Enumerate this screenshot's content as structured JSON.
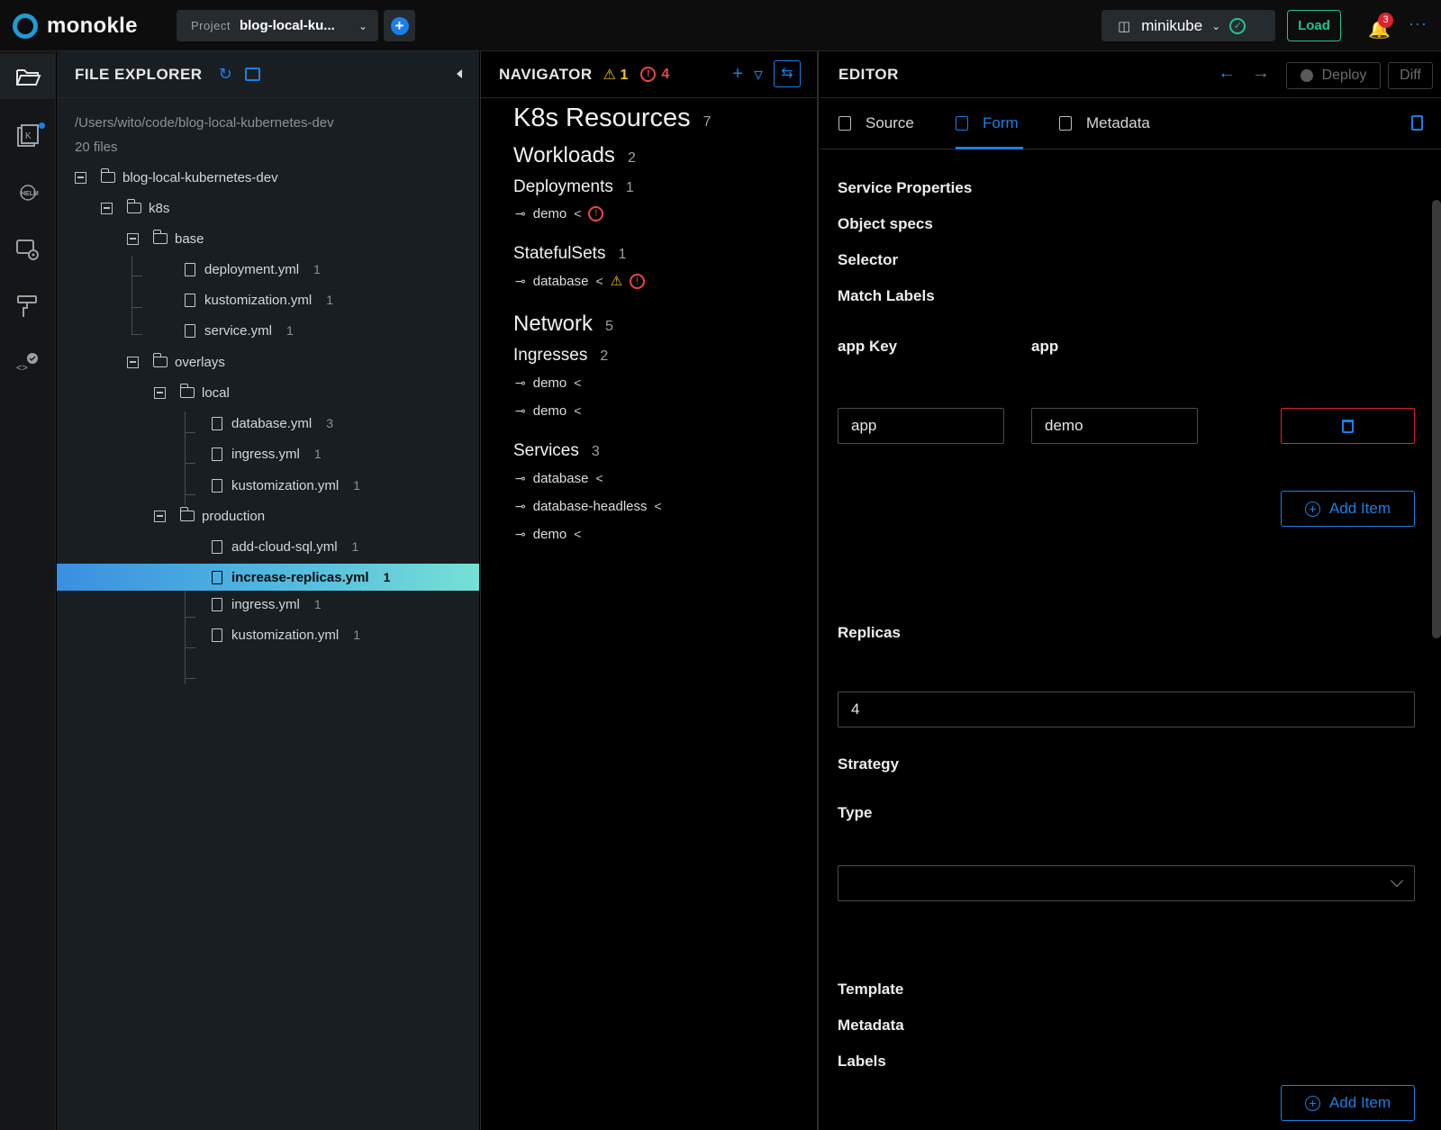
{
  "app": {
    "name": "monokle"
  },
  "topbar": {
    "project_label": "Project",
    "project_name": "blog-local-ku...",
    "cluster_name": "minikube",
    "load_label": "Load",
    "notification_count": "3"
  },
  "explorer": {
    "title": "FILE EXPLORER",
    "path": "/Users/wito/code/blog-local-kubernetes-dev",
    "file_count": "20 files",
    "tree": [
      {
        "label": "blog-local-kubernetes-dev",
        "type": "folder",
        "count": ""
      },
      {
        "label": "k8s",
        "type": "folder",
        "count": ""
      },
      {
        "label": "base",
        "type": "folder",
        "count": ""
      },
      {
        "label": "deployment.yml",
        "type": "file",
        "count": "1"
      },
      {
        "label": "kustomization.yml",
        "type": "file",
        "count": "1"
      },
      {
        "label": "service.yml",
        "type": "file",
        "count": "1"
      },
      {
        "label": "overlays",
        "type": "folder",
        "count": ""
      },
      {
        "label": "local",
        "type": "folder",
        "count": ""
      },
      {
        "label": "database.yml",
        "type": "file",
        "count": "3"
      },
      {
        "label": "ingress.yml",
        "type": "file",
        "count": "1"
      },
      {
        "label": "kustomization.yml",
        "type": "file",
        "count": "1"
      },
      {
        "label": "production",
        "type": "folder",
        "count": ""
      },
      {
        "label": "add-cloud-sql.yml",
        "type": "file",
        "count": "1"
      },
      {
        "label": "increase-replicas.yml",
        "type": "file",
        "count": "1",
        "selected": true
      },
      {
        "label": "ingress.yml",
        "type": "file",
        "count": "1"
      },
      {
        "label": "kustomization.yml",
        "type": "file",
        "count": "1"
      }
    ]
  },
  "navigator": {
    "title": "NAVIGATOR",
    "warning_count": "1",
    "error_count": "4",
    "root": {
      "label": "K8s Resources",
      "count": "7"
    },
    "workloads": {
      "label": "Workloads",
      "count": "2"
    },
    "deployments": {
      "label": "Deployments",
      "count": "1",
      "items": [
        "demo"
      ]
    },
    "statefulsets": {
      "label": "StatefulSets",
      "count": "1",
      "items": [
        "database"
      ]
    },
    "network": {
      "label": "Network",
      "count": "5"
    },
    "ingresses": {
      "label": "Ingresses",
      "count": "2",
      "items": [
        "demo",
        "demo"
      ]
    },
    "services": {
      "label": "Services",
      "count": "3",
      "items": [
        "database",
        "database-headless",
        "demo"
      ]
    }
  },
  "editor": {
    "title": "EDITOR",
    "deploy_label": "Deploy",
    "diff_label": "Diff",
    "tabs": [
      "Source",
      "Form",
      "Metadata"
    ],
    "active_tab": "Form",
    "form": {
      "service_properties": "Service Properties",
      "object_specs": "Object specs",
      "selector": "Selector",
      "match_labels": "Match Labels",
      "key_label": "app Key",
      "value_label": "app",
      "key_value": "app",
      "value_value": "demo",
      "add_item": "Add Item",
      "replicas_label": "Replicas",
      "replicas_value": "4",
      "strategy": "Strategy",
      "type_label": "Type",
      "template": "Template",
      "metadata": "Metadata",
      "labels": "Labels"
    }
  },
  "colors": {
    "accent": "#1d7ee6",
    "success": "#25c38b",
    "warning": "#f5c518",
    "error": "#e84749"
  }
}
